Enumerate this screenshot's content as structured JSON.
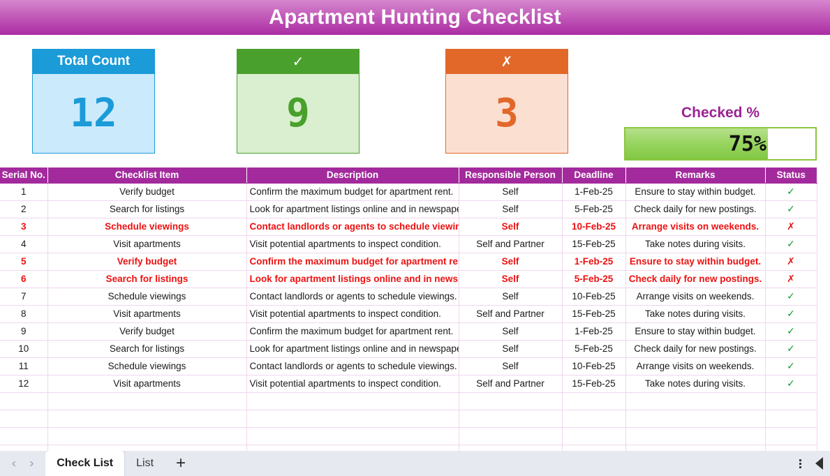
{
  "banner": {
    "title": "Apartment Hunting Checklist"
  },
  "kpis": [
    {
      "name": "total-count",
      "label": "Total Count",
      "value": "12",
      "header_color": "#1b9bd8",
      "body_color": "#cbeafb"
    },
    {
      "name": "checked",
      "label": "✓",
      "value": "9",
      "header_color": "#4aa02c",
      "body_color": "#d9efcf"
    },
    {
      "name": "unchecked",
      "label": "✗",
      "value": "3",
      "header_color": "#e2682a",
      "body_color": "#fbe0d2"
    }
  ],
  "gauge": {
    "label": "Checked %",
    "value_text": "75%",
    "percent": 75,
    "fill_color": "#8cc63f",
    "label_color": "#9b2393"
  },
  "table": {
    "columns": [
      "Serial No.",
      "Checklist Item",
      "Description",
      "Responsible Person",
      "Deadline",
      "Remarks",
      "Status"
    ],
    "header_color": "#a32a9c",
    "flag_color": "#ee1111",
    "rows": [
      {
        "serial": "1",
        "item": "Verify budget",
        "description": "Confirm the maximum budget for apartment rent.",
        "person": "Self",
        "deadline": "1-Feb-25",
        "remarks": "Ensure to stay within budget.",
        "status": "✓",
        "flagged": false
      },
      {
        "serial": "2",
        "item": "Search for listings",
        "description": "Look for apartment listings online and in newspapers.",
        "person": "Self",
        "deadline": "5-Feb-25",
        "remarks": "Check daily for new postings.",
        "status": "✓",
        "flagged": false
      },
      {
        "serial": "3",
        "item": "Schedule viewings",
        "description": "Contact landlords or agents to schedule viewings.",
        "person": "Self",
        "deadline": "10-Feb-25",
        "remarks": "Arrange visits on weekends.",
        "status": "✗",
        "flagged": true
      },
      {
        "serial": "4",
        "item": "Visit apartments",
        "description": "Visit potential apartments to inspect condition.",
        "person": "Self and Partner",
        "deadline": "15-Feb-25",
        "remarks": "Take notes during visits.",
        "status": "✓",
        "flagged": false
      },
      {
        "serial": "5",
        "item": "Verify budget",
        "description": "Confirm the maximum budget for apartment rent.",
        "person": "Self",
        "deadline": "1-Feb-25",
        "remarks": "Ensure to stay within budget.",
        "status": "✗",
        "flagged": true
      },
      {
        "serial": "6",
        "item": "Search for listings",
        "description": "Look for apartment listings online and in newspapers.",
        "person": "Self",
        "deadline": "5-Feb-25",
        "remarks": "Check daily for new postings.",
        "status": "✗",
        "flagged": true
      },
      {
        "serial": "7",
        "item": "Schedule viewings",
        "description": "Contact landlords or agents to schedule viewings.",
        "person": "Self",
        "deadline": "10-Feb-25",
        "remarks": "Arrange visits on weekends.",
        "status": "✓",
        "flagged": false
      },
      {
        "serial": "8",
        "item": "Visit apartments",
        "description": "Visit potential apartments to inspect condition.",
        "person": "Self and Partner",
        "deadline": "15-Feb-25",
        "remarks": "Take notes during visits.",
        "status": "✓",
        "flagged": false
      },
      {
        "serial": "9",
        "item": "Verify budget",
        "description": "Confirm the maximum budget for apartment rent.",
        "person": "Self",
        "deadline": "1-Feb-25",
        "remarks": "Ensure to stay within budget.",
        "status": "✓",
        "flagged": false
      },
      {
        "serial": "10",
        "item": "Search for listings",
        "description": "Look for apartment listings online and in newspapers.",
        "person": "Self",
        "deadline": "5-Feb-25",
        "remarks": "Check daily for new postings.",
        "status": "✓",
        "flagged": false
      },
      {
        "serial": "11",
        "item": "Schedule viewings",
        "description": "Contact landlords or agents to schedule viewings.",
        "person": "Self",
        "deadline": "10-Feb-25",
        "remarks": "Arrange visits on weekends.",
        "status": "✓",
        "flagged": false
      },
      {
        "serial": "12",
        "item": "Visit apartments",
        "description": "Visit potential apartments to inspect condition.",
        "person": "Self and Partner",
        "deadline": "15-Feb-25",
        "remarks": "Take notes during visits.",
        "status": "✓",
        "flagged": false
      },
      {
        "serial": "",
        "item": "",
        "description": "",
        "person": "",
        "deadline": "",
        "remarks": "",
        "status": "",
        "flagged": false
      },
      {
        "serial": "",
        "item": "",
        "description": "",
        "person": "",
        "deadline": "",
        "remarks": "",
        "status": "",
        "flagged": false
      },
      {
        "serial": "",
        "item": "",
        "description": "",
        "person": "",
        "deadline": "",
        "remarks": "",
        "status": "",
        "flagged": false
      },
      {
        "serial": "",
        "item": "",
        "description": "",
        "person": "",
        "deadline": "",
        "remarks": "",
        "status": "",
        "flagged": false
      }
    ]
  },
  "sheetbar": {
    "prev_label": "‹",
    "next_label": "›",
    "tabs": [
      {
        "label": "Check List",
        "active": true
      },
      {
        "label": "List",
        "active": false
      }
    ],
    "add_label": "+"
  }
}
